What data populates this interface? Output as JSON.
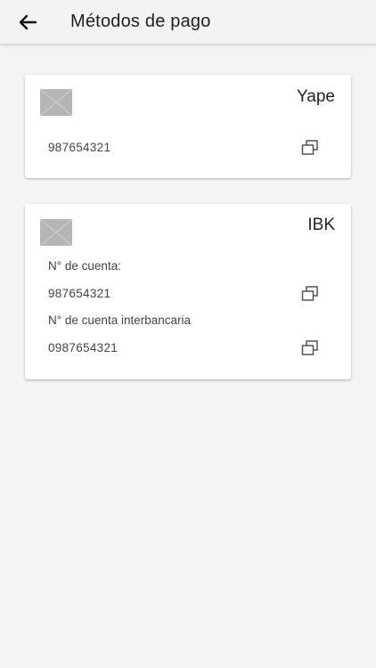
{
  "header": {
    "title": "Métodos de pago",
    "back_icon": "arrow-left-icon"
  },
  "payment_methods": [
    {
      "name": "Yape",
      "logo": "placeholder-image",
      "fields": [
        {
          "label": "",
          "value": "987654321"
        }
      ]
    },
    {
      "name": "IBK",
      "logo": "placeholder-image",
      "fields": [
        {
          "label": "N° de cuenta:",
          "value": "987654321"
        },
        {
          "label": "N° de cuenta interbancaria",
          "value": "0987654321"
        }
      ]
    }
  ],
  "colors": {
    "background": "#f4f4f4",
    "app_bar": "#f2f3f7",
    "card": "#ffffff",
    "text": "#222222",
    "icon": "#555555"
  }
}
